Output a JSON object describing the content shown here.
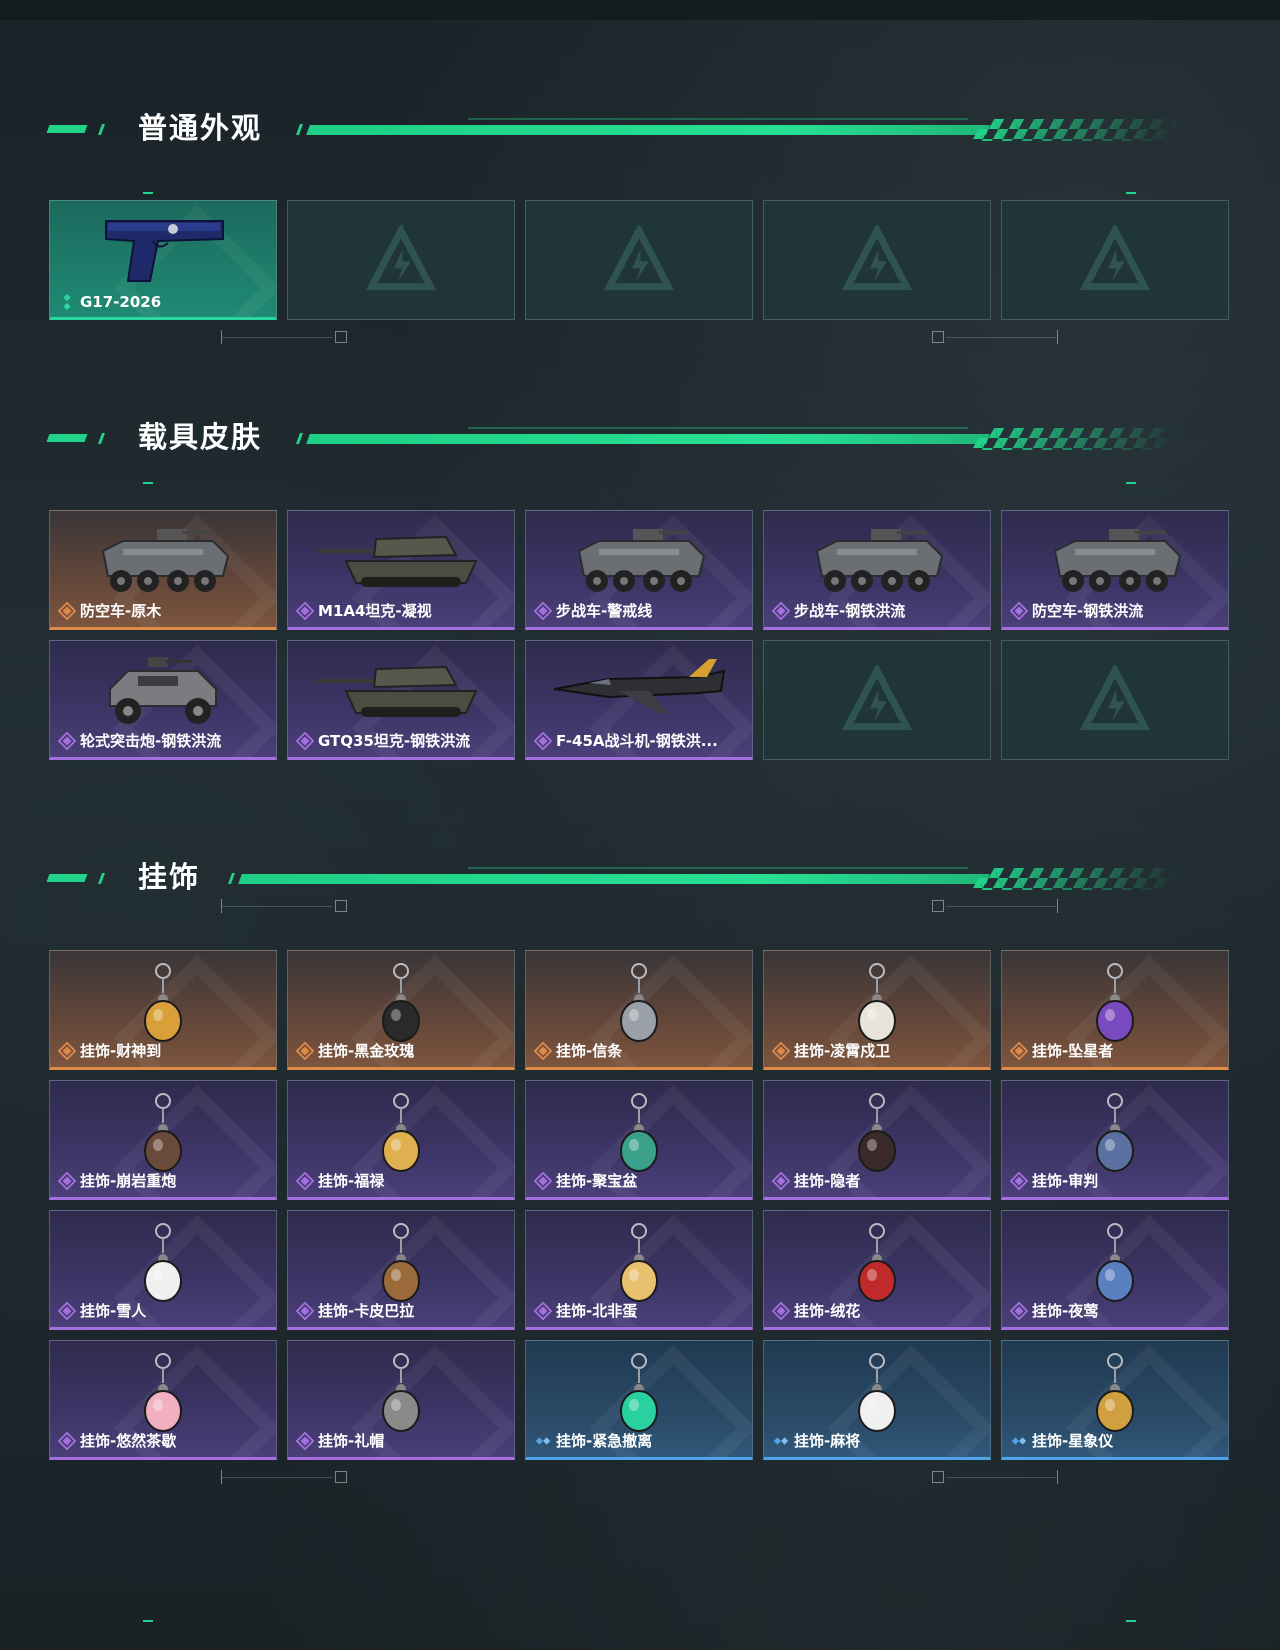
{
  "sections": [
    {
      "title": "普通外观",
      "items": [
        {
          "label": "G17-2026",
          "rarity": "green",
          "art": "pistol"
        },
        {
          "label": "",
          "rarity": "empty"
        },
        {
          "label": "",
          "rarity": "empty"
        },
        {
          "label": "",
          "rarity": "empty"
        },
        {
          "label": "",
          "rarity": "empty"
        }
      ]
    },
    {
      "title": "载具皮肤",
      "items": [
        {
          "label": "防空车-原木",
          "rarity": "orange",
          "art": "apc"
        },
        {
          "label": "M1A4坦克-凝视",
          "rarity": "purple",
          "art": "tank"
        },
        {
          "label": "步战车-警戒线",
          "rarity": "purple",
          "art": "apc"
        },
        {
          "label": "步战车-钢铁洪流",
          "rarity": "purple",
          "art": "apc"
        },
        {
          "label": "防空车-钢铁洪流",
          "rarity": "purple",
          "art": "apc"
        },
        {
          "label": "轮式突击炮-钢铁洪流",
          "rarity": "purple",
          "art": "jeep"
        },
        {
          "label": "GTQ35坦克-钢铁洪流",
          "rarity": "purple",
          "art": "tank"
        },
        {
          "label": "F-45A战斗机-钢铁洪...",
          "rarity": "purple",
          "art": "jet"
        },
        {
          "label": "",
          "rarity": "empty"
        },
        {
          "label": "",
          "rarity": "empty"
        }
      ]
    },
    {
      "title": "挂饰",
      "items": [
        {
          "label": "挂饰-财神到",
          "rarity": "orange",
          "art": "charm",
          "color": "#d9a03a"
        },
        {
          "label": "挂饰-黑金玫瑰",
          "rarity": "orange",
          "art": "charm",
          "color": "#2a2a2a"
        },
        {
          "label": "挂饰-信条",
          "rarity": "orange",
          "art": "charm",
          "color": "#9aa0a8"
        },
        {
          "label": "挂饰-凌霄戍卫",
          "rarity": "orange",
          "art": "charm",
          "color": "#e8e4dc"
        },
        {
          "label": "挂饰-坠星者",
          "rarity": "orange",
          "art": "charm",
          "color": "#7a4ac0"
        },
        {
          "label": "挂饰-崩岩重炮",
          "rarity": "purple",
          "art": "charm",
          "color": "#6a4a3a"
        },
        {
          "label": "挂饰-福禄",
          "rarity": "purple",
          "art": "charm",
          "color": "#e0b050"
        },
        {
          "label": "挂饰-聚宝盆",
          "rarity": "purple",
          "art": "charm",
          "color": "#3aa08a"
        },
        {
          "label": "挂饰-隐者",
          "rarity": "purple",
          "art": "charm",
          "color": "#3a2a2a"
        },
        {
          "label": "挂饰-审判",
          "rarity": "purple",
          "art": "charm",
          "color": "#5a70a0"
        },
        {
          "label": "挂饰-雪人",
          "rarity": "purple",
          "art": "charm",
          "color": "#f0f0f0"
        },
        {
          "label": "挂饰-卡皮巴拉",
          "rarity": "purple",
          "art": "charm",
          "color": "#9a6a3a"
        },
        {
          "label": "挂饰-北非蛋",
          "rarity": "purple",
          "art": "charm",
          "color": "#e8c070"
        },
        {
          "label": "挂饰-绒花",
          "rarity": "purple",
          "art": "charm",
          "color": "#c02a2a"
        },
        {
          "label": "挂饰-夜莺",
          "rarity": "purple",
          "art": "charm",
          "color": "#5a80c0"
        },
        {
          "label": "挂饰-悠然茶歇",
          "rarity": "purple",
          "art": "charm",
          "color": "#f0b0c0"
        },
        {
          "label": "挂饰-礼帽",
          "rarity": "purple",
          "art": "charm",
          "color": "#8a8a8a"
        },
        {
          "label": "挂饰-紧急撤离",
          "rarity": "blue",
          "art": "charm",
          "color": "#2ad0a0"
        },
        {
          "label": "挂饰-麻将",
          "rarity": "blue",
          "art": "charm",
          "color": "#f0f0f0"
        },
        {
          "label": "挂饰-星象仪",
          "rarity": "blue",
          "art": "charm",
          "color": "#d0a040"
        }
      ]
    }
  ],
  "colors": {
    "accent": "#22d38a",
    "orange": "#e08a4a",
    "purple": "#a470e0",
    "blue": "#4fa3e8",
    "green": "#2cd6a0"
  }
}
